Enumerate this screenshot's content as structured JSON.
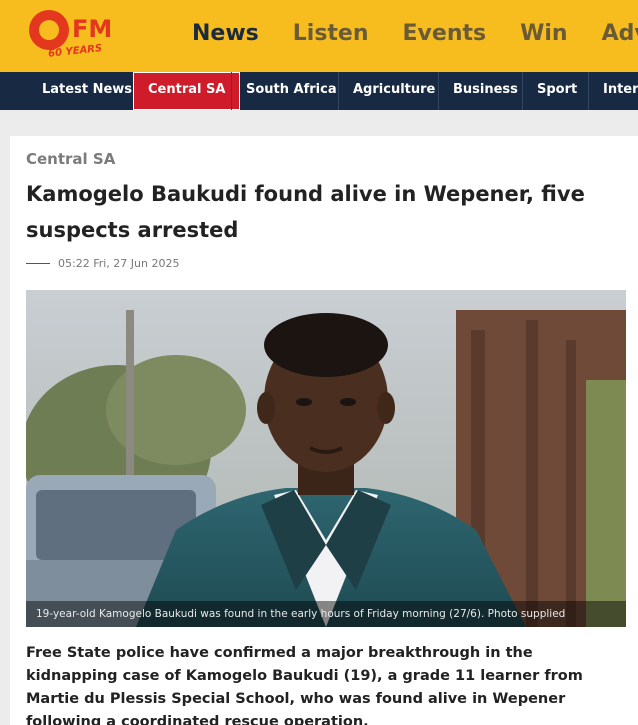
{
  "logo": {
    "letters": "OFM",
    "tagline": "60 YEARS",
    "icon": "ofm-logo-icon"
  },
  "main_nav": [
    "News",
    "Listen",
    "Events",
    "Win",
    "Adver"
  ],
  "sub_nav": [
    "Latest News",
    "Central SA",
    "South Africa",
    "Agriculture",
    "Business",
    "Sport",
    "Intern"
  ],
  "colors": {
    "topbar": "#f7bd1e",
    "subnav": "#182a43",
    "active_tab": "#cf1c2b"
  },
  "article": {
    "category": "Central SA",
    "headline": "Kamogelo Baukudi found alive in Wepener, five suspects arrested",
    "date": "05:22 Fri, 27 Jun 2025",
    "caption": "19-year-old Kamogelo Baukudi was found in the early hours of Friday morning (27/6). Photo supplied",
    "body": "Free State police have confirmed a major breakthrough in the kidnapping case of Kamogelo Baukudi (19), a grade 11 learner from Martie du Plessis Special School, who was found alive in Wepener following a coordinated rescue operation."
  }
}
